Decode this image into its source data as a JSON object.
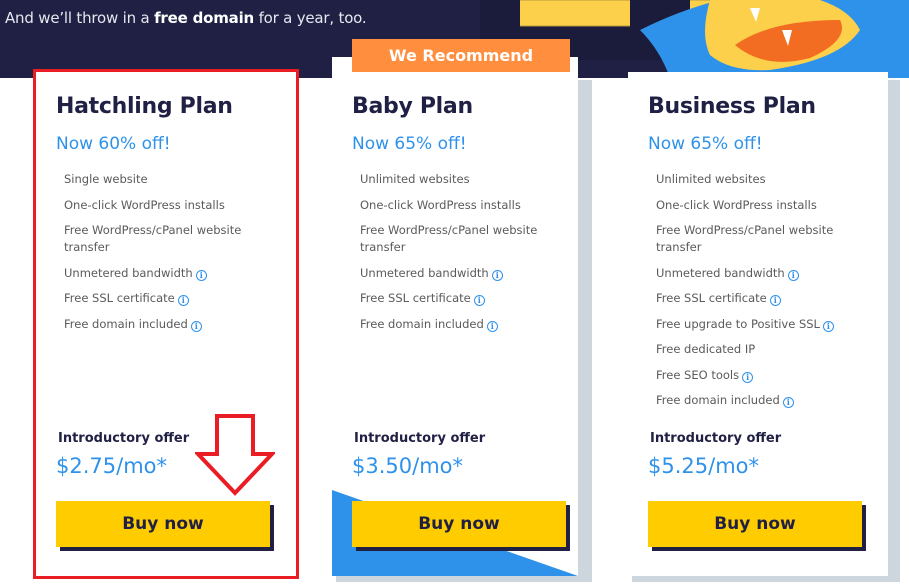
{
  "hero": {
    "tagline_prefix": "And we’ll throw in a ",
    "tagline_bold": "free domain",
    "tagline_suffix": " for a year, too."
  },
  "recommend_badge": "We Recommend",
  "colors": {
    "navy": "#1f2044",
    "accent_blue": "#2f92ea",
    "button_yellow": "#ffcc00",
    "badge_orange": "#ff8e3f",
    "highlight_red": "#ea1c24"
  },
  "plans": [
    {
      "title": "Hatchling Plan",
      "discount": "Now 60% off!",
      "features": [
        {
          "text": "Single website",
          "info": false
        },
        {
          "text": "One-click WordPress installs",
          "info": false
        },
        {
          "text": "Free WordPress/cPanel website transfer",
          "info": false
        },
        {
          "text": "Unmetered bandwidth",
          "info": true
        },
        {
          "text": "Free SSL certificate",
          "info": true
        },
        {
          "text": "Free domain included",
          "info": true
        }
      ],
      "intro_label": "Introductory offer",
      "price": "$2.75/mo*",
      "button": "Buy now",
      "highlighted": true
    },
    {
      "title": "Baby Plan",
      "discount": "Now 65% off!",
      "features": [
        {
          "text": "Unlimited websites",
          "info": false
        },
        {
          "text": "One-click WordPress installs",
          "info": false
        },
        {
          "text": "Free WordPress/cPanel website transfer",
          "info": false
        },
        {
          "text": "Unmetered bandwidth",
          "info": true
        },
        {
          "text": "Free SSL certificate",
          "info": true
        },
        {
          "text": "Free domain included",
          "info": true
        }
      ],
      "intro_label": "Introductory offer",
      "price": "$3.50/mo*",
      "button": "Buy now",
      "recommended": true
    },
    {
      "title": "Business Plan",
      "discount": "Now 65% off!",
      "features": [
        {
          "text": "Unlimited websites",
          "info": false
        },
        {
          "text": "One-click WordPress installs",
          "info": false
        },
        {
          "text": "Free WordPress/cPanel website transfer",
          "info": false
        },
        {
          "text": "Unmetered bandwidth",
          "info": true
        },
        {
          "text": "Free SSL certificate",
          "info": true
        },
        {
          "text": "Free upgrade to Positive SSL",
          "info": true
        },
        {
          "text": "Free dedicated IP",
          "info": false
        },
        {
          "text": "Free SEO tools",
          "info": true
        },
        {
          "text": "Free domain included",
          "info": true
        }
      ],
      "intro_label": "Introductory offer",
      "price": "$5.25/mo*",
      "button": "Buy now"
    }
  ]
}
